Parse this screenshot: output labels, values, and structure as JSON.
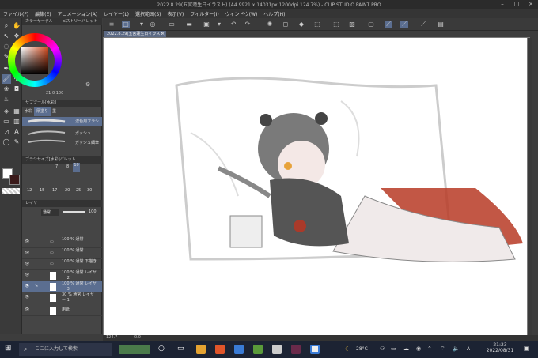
{
  "window": {
    "title": "2022.8.29(五宮蓮生日イラスト) (A4 9921 x 14031px 1200dpi 124.7%) - CLIP STUDIO PAINT PRO"
  },
  "menu": [
    "ファイル(F)",
    "編集(E)",
    "アニメーション(A)",
    "レイヤー(L)",
    "選択範囲(S)",
    "表示(V)",
    "フィルター(I)",
    "ウィンドウ(W)",
    "ヘルプ(H)"
  ],
  "document_tab": "2022.8.29(五宮蓮生日イラスト)",
  "color_panel": {
    "tabs": [
      "カラーサークル",
      "ヒストリーパレット"
    ],
    "readout": "21 0 100"
  },
  "subtool_panel": {
    "title": "サブツール[水彩]",
    "tabs": [
      "水彩",
      "厚塗り",
      "墨"
    ],
    "brushes": [
      "濃色用ブラシ",
      "ガッシュ",
      "ガッシュ細筆"
    ]
  },
  "brush_size_panel": {
    "title": "ブラシサイズ[水彩]パレット",
    "sizes": [
      "12",
      "15",
      "17",
      "20",
      "25",
      "30"
    ],
    "row1": [
      "7",
      "8",
      "10"
    ]
  },
  "layer_panel": {
    "title": "レイヤー",
    "blend_mode": "通常",
    "opacity": "100",
    "layers": [
      {
        "name": "100 % 通常"
      },
      {
        "name": "100 % 通常"
      },
      {
        "name": "100 % 通常 下描き"
      },
      {
        "name": "100 % 通常 レイヤー 2"
      },
      {
        "name": "100 % 通常 レイヤー 3",
        "selected": true
      },
      {
        "name": "30 % 通常 レイヤー 1"
      },
      {
        "name": "用紙"
      }
    ]
  },
  "status": {
    "zoom": "124.7",
    "angle": "0.0"
  },
  "taskbar": {
    "search_placeholder": "ここに入力して検索",
    "temperature": "28°C",
    "ime": "A",
    "time": "21:23",
    "date": "2022/08/31"
  },
  "colors": {
    "accent": "#5b6e90",
    "main_color": "#ffffff",
    "sub_color": "#3a1a1a"
  }
}
